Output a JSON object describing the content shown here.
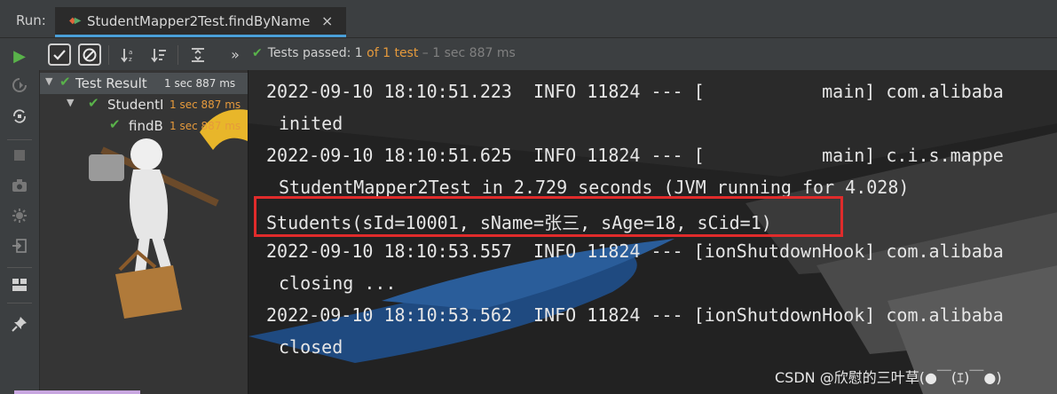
{
  "run_bar": {
    "label": "Run:",
    "tab_title": "StudentMapper2Test.findByName",
    "tab_close": "×"
  },
  "toolbar": {
    "status_prefix": "Tests passed: ",
    "status_count": "1",
    "status_of": "of 1 test",
    "status_duration": " – 1 sec 887 ms",
    "more": "»"
  },
  "tree": {
    "items": [
      {
        "label": "Test Result",
        "time": "1 sec 887 ms"
      },
      {
        "label": "StudentI",
        "time": "1 sec 887 ms"
      },
      {
        "label": "findB",
        "time": "1 sec 887 ms"
      }
    ]
  },
  "console": {
    "lines": [
      "2022-09-10 18:10:51.223  INFO 11824 --- [           main] com.alibaba",
      "inited",
      "2022-09-10 18:10:51.625  INFO 11824 --- [           main] c.i.s.mappe",
      "StudentMapper2Test in 2.729 seconds (JVM running for 4.028)",
      "Students(sId=10001, sName=张三, sAge=18, sCid=1)",
      "2022-09-10 18:10:53.557  INFO 11824 --- [ionShutdownHook] com.alibaba",
      "closing ...",
      "2022-09-10 18:10:53.562  INFO 11824 --- [ionShutdownHook] com.alibaba",
      "closed"
    ]
  },
  "watermark": "CSDN @欣慰的三叶草(●￣(ｴ)￣●)",
  "colors": {
    "accent_tab": "#4a9fd8",
    "pass_green": "#59b24a",
    "time_orange": "#e69a3c",
    "highlight_red": "#e02b2b"
  }
}
